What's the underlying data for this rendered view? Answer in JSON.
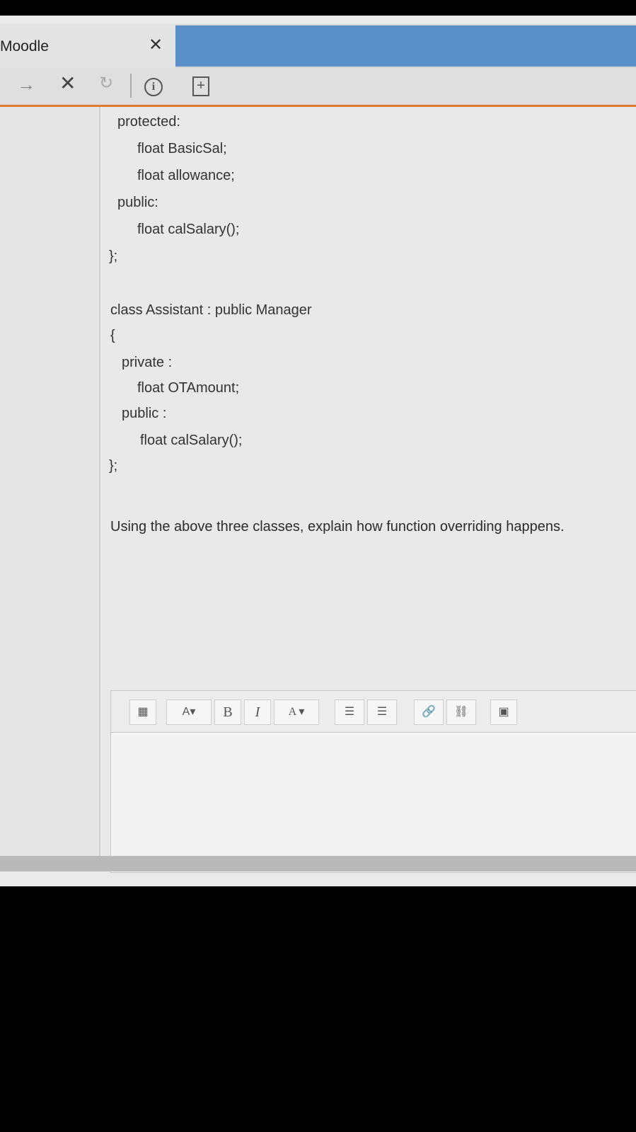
{
  "tab": {
    "title": "Moodle",
    "close": "✕"
  },
  "toolbar": {
    "forward": "→",
    "stop": "✕",
    "reload": "↻",
    "info": "i",
    "page": "+"
  },
  "code": {
    "lines": [
      "protected:",
      "float BasicSal;",
      "float allowance;",
      "public:",
      "float calSalary();",
      "};",
      "class Assistant : public Manager",
      "{",
      "private :",
      "float OTAmount;",
      "public :",
      "float calSalary();",
      "};"
    ]
  },
  "question": "Using the above three classes, explain how function overriding happens.",
  "editor": {
    "buttons": {
      "toggle": "▦",
      "paragraph": "A▾",
      "bold": "B",
      "italic": "I",
      "font_color": "A ▾",
      "bullet_list": "☰",
      "numbered_list": "☰",
      "link": "🔗",
      "unlink": "⛓",
      "image": "▣"
    }
  }
}
